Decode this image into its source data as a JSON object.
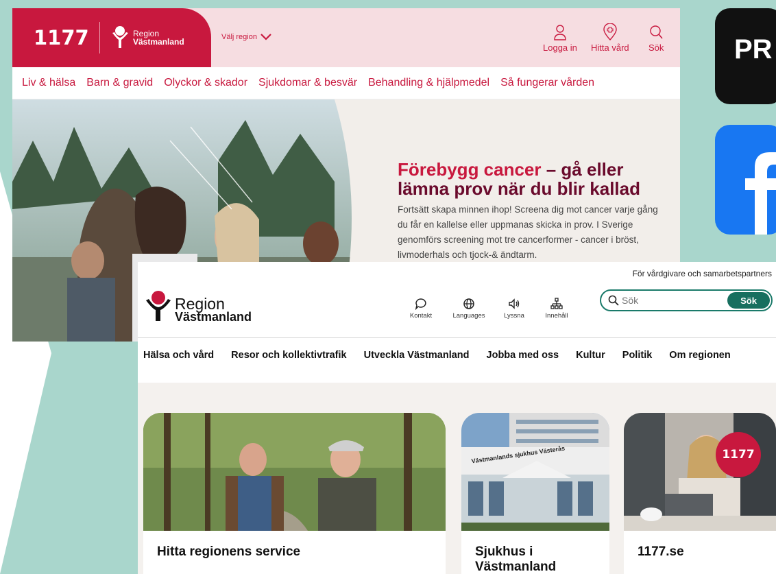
{
  "site_1177": {
    "logo": "1177",
    "region_line1": "Region",
    "region_line2": "Västmanland",
    "select_region": "Välj region",
    "tools": [
      {
        "label": "Logga in",
        "icon": "user-icon"
      },
      {
        "label": "Hitta vård",
        "icon": "location-pin-icon"
      },
      {
        "label": "Sök",
        "icon": "search-icon"
      }
    ],
    "nav": [
      "Liv & hälsa",
      "Barn & gravid",
      "Olyckor & skador",
      "Sjukdomar & besvär",
      "Behandling & hjälpmedel",
      "Så fungerar vården"
    ],
    "hero": {
      "title_accent": "Förebygg cancer",
      "title_rest": " – gå eller lämna prov när du blir kallad",
      "body": "Fortsätt skapa minnen ihop! Screena dig mot cancer varje gång du får en kallelse eller uppmanas skicka in prov. I Sverige genomförs screening mot tre cancerformer - cancer i bröst, livmoderhals och tjock-& ändtarm."
    },
    "colors": {
      "brand": "#c8183e",
      "header_bg": "#f6dde1"
    }
  },
  "tiles": {
    "pr_text": "PR",
    "fb_icon": "facebook-icon"
  },
  "site_region": {
    "partners_link": "För vårdgivare och samarbetspartners",
    "logo_line1": "Region",
    "logo_line2": "Västmanland",
    "tools": [
      {
        "label": "Kontakt",
        "icon": "chat-bubble-icon"
      },
      {
        "label": "Languages",
        "icon": "globe-icon"
      },
      {
        "label": "Lyssna",
        "icon": "speaker-icon"
      },
      {
        "label": "Innehåll",
        "icon": "sitemap-icon"
      }
    ],
    "search": {
      "placeholder": "Sök",
      "button": "Sök"
    },
    "nav": [
      "Hälsa och vård",
      "Resor och kollektivtrafik",
      "Utveckla Västmanland",
      "Jobba med oss",
      "Kultur",
      "Politik",
      "Om regionen"
    ],
    "cards": [
      {
        "title": "Hitta regionens service"
      },
      {
        "title": "Sjukhus i Västmanland",
        "sign": "Västmanlands sjukhus Västerås"
      },
      {
        "title": "1177.se",
        "badge": "1177"
      }
    ],
    "colors": {
      "accent": "#176f5f",
      "content_bg": "#f4f1ee"
    }
  }
}
